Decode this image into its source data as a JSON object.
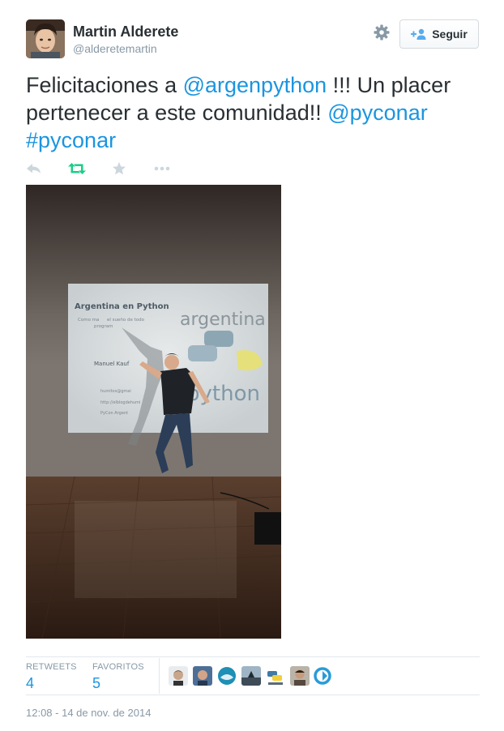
{
  "user": {
    "full_name": "Martin Alderete",
    "username": "@alderetemartin"
  },
  "follow_button": {
    "label": "Seguir"
  },
  "tweet": {
    "text_plain_1": "Felicitaciones a ",
    "mention_1": "@argenpython",
    "text_plain_2": " !!! Un placer pertenecer a este comunidad!! ",
    "mention_2": "@pyconar",
    "hashtag": "#pyconar"
  },
  "photo": {
    "slide_title": "Argentina en Python",
    "slide_subtitle_1": "Como ma",
    "slide_subtitle_2": "el sueño de todo",
    "slide_subtitle_3": "program",
    "slide_word_argentina": "argentina",
    "slide_word_python": "python",
    "slide_presenter": "Manuel Kauf",
    "slide_contact_1": "humitos@gmai",
    "slide_contact_2": "http://elblogdehumi",
    "slide_contact_3": "PyCon Argent"
  },
  "stats": {
    "retweets_label": "RETWEETS",
    "retweets_count": "4",
    "favorites_label": "FAVORITOS",
    "favorites_count": "5"
  },
  "timestamp": "12:08 - 14 de nov. de 2014",
  "colors": {
    "link": "#1b95e0",
    "retweet_icon": "#19cf86",
    "muted": "#8899a6"
  },
  "icons": {
    "reply": "reply-icon",
    "retweet": "retweet-icon",
    "favorite": "star-icon",
    "more": "more-icon",
    "settings": "gear-icon",
    "follow": "add-user-icon"
  }
}
